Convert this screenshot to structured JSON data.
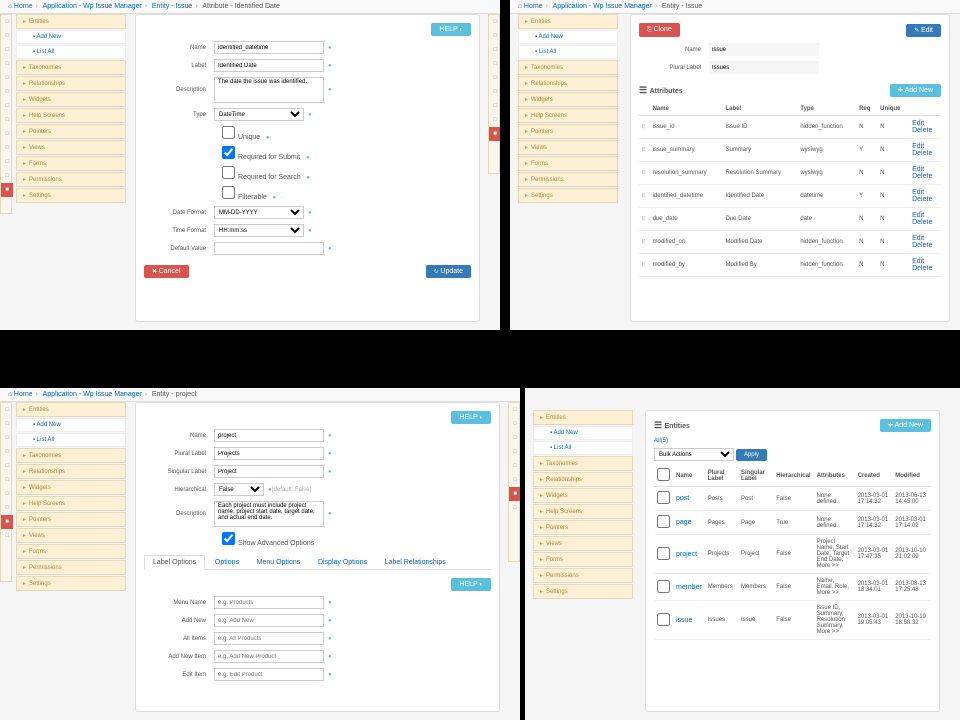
{
  "q1": {
    "crumbs": [
      "Home",
      "Application - Wp Issue Manager",
      "Entity - Issue",
      "Attribute - Identified Date"
    ],
    "sidebar": [
      {
        "t": "sec",
        "label": "Entities"
      },
      {
        "t": "sub",
        "label": "Add New"
      },
      {
        "t": "sub",
        "label": "List All"
      },
      {
        "t": "sec",
        "label": "Taxonomies"
      },
      {
        "t": "sec",
        "label": "Relationships"
      },
      {
        "t": "sec",
        "label": "Widgets"
      },
      {
        "t": "sec",
        "label": "Help Screens"
      },
      {
        "t": "sec",
        "label": "Pointers"
      },
      {
        "t": "sec",
        "label": "Views"
      },
      {
        "t": "sec",
        "label": "Forms"
      },
      {
        "t": "sec",
        "label": "Permissions"
      },
      {
        "t": "sec",
        "label": "Settings"
      }
    ],
    "help": "HELP",
    "fields": {
      "name_l": "Name",
      "name_v": "identified_datetime",
      "label_l": "Label",
      "label_v": "Identified Date",
      "desc_l": "Description",
      "desc_v": "The date the issue was identified.",
      "type_l": "Type",
      "type_v": "DateTime",
      "unique": "Unique",
      "reqsub": "Required for Submit",
      "reqsea": "Required for Search",
      "filt": "Filterable",
      "datef_l": "Date Format",
      "datef_v": "MM-DD-YYYY",
      "timef_l": "Time Format",
      "timef_v": "HH:mm:ss",
      "defv_l": "Default Value"
    },
    "cancel": "Cancel",
    "update": "Update"
  },
  "q2": {
    "crumbs": [
      "Home",
      "Application - Wp Issue Manager",
      "Entity - Issue"
    ],
    "sidebar": [
      {
        "t": "sec",
        "label": "Entities"
      },
      {
        "t": "sub",
        "label": "Add New"
      },
      {
        "t": "sub",
        "label": "List All"
      },
      {
        "t": "sec",
        "label": "Taxonomies"
      },
      {
        "t": "sec",
        "label": "Relationships"
      },
      {
        "t": "sec",
        "label": "Widgets"
      },
      {
        "t": "sec",
        "label": "Help Screens"
      },
      {
        "t": "sec",
        "label": "Pointers"
      },
      {
        "t": "sec",
        "label": "Views"
      },
      {
        "t": "sec",
        "label": "Forms"
      },
      {
        "t": "sec",
        "label": "Permissions"
      },
      {
        "t": "sec",
        "label": "Settings"
      }
    ],
    "clone": "Clone",
    "edit": "Edit",
    "name_l": "Name",
    "name_v": "issue",
    "plural_l": "Plural Label",
    "plural_v": "Issues",
    "attrs_title": "Attributes",
    "addnew": "Add New",
    "cols": {
      "name": "Name",
      "label": "Label",
      "type": "Type",
      "req": "Req",
      "unique": "Unique"
    },
    "rows": [
      {
        "name": "issue_id",
        "label": "Issue ID",
        "type": "hidden_function",
        "req": "N",
        "unique": "N"
      },
      {
        "name": "issue_summary",
        "label": "Summary",
        "type": "wysiwyg",
        "req": "Y",
        "unique": "N"
      },
      {
        "name": "resolution_summary",
        "label": "Resolution Summary",
        "type": "wysiwyg",
        "req": "N",
        "unique": "N"
      },
      {
        "name": "identified_datetime",
        "label": "Identified Date",
        "type": "datetime",
        "req": "Y",
        "unique": "N"
      },
      {
        "name": "due_date",
        "label": "Due Date",
        "type": "date",
        "req": "N",
        "unique": "N"
      },
      {
        "name": "modified_on",
        "label": "Modified Date",
        "type": "hidden_function",
        "req": "N",
        "unique": "N"
      },
      {
        "name": "modified_by",
        "label": "Modified By",
        "type": "hidden_function",
        "req": "N",
        "unique": "N"
      }
    ],
    "editlink": "Edit",
    "deletelink": "Delete"
  },
  "q3": {
    "crumbs": [
      "Home",
      "Application - Wp Issue Manager",
      "Entity - project"
    ],
    "sidebar": [
      {
        "t": "sec",
        "label": "Entities"
      },
      {
        "t": "sub",
        "label": "Add New"
      },
      {
        "t": "sub",
        "label": "List All"
      },
      {
        "t": "sec",
        "label": "Taxonomies"
      },
      {
        "t": "sec",
        "label": "Relationships"
      },
      {
        "t": "sec",
        "label": "Widgets"
      },
      {
        "t": "sec",
        "label": "Help Screens"
      },
      {
        "t": "sec",
        "label": "Pointers"
      },
      {
        "t": "sec",
        "label": "Views"
      },
      {
        "t": "sec",
        "label": "Forms"
      },
      {
        "t": "sec",
        "label": "Permissions"
      },
      {
        "t": "sec",
        "label": "Settings"
      }
    ],
    "help": "HELP",
    "fields": {
      "name_l": "Name",
      "name_v": "project",
      "plural_l": "Plural Label",
      "plural_v": "Projects",
      "sing_l": "Singular Label",
      "sing_v": "Project",
      "hier_l": "Hierarchical",
      "hier_v": "False",
      "hier_hint": "(default: False)",
      "desc_l": "Description",
      "desc_v": "Each project must include project name, project start date, target date, and actual end date.",
      "showadv": "Show Advanced Options"
    },
    "tabs": [
      "Label Options",
      "Options",
      "Menu Options",
      "Display Options",
      "Label Relationships"
    ],
    "f2": {
      "menu_l": "Menu Name",
      "menu_p": "e.g. Products",
      "addnew_l": "Add New",
      "addnew_p": "e.g. Add New",
      "all_l": "All Items",
      "all_p": "e.g. All Products",
      "addni_l": "Add New Item",
      "addni_p": "e.g. Add New Product",
      "edit_l": "Edit Item",
      "edit_p": "e.g. Edit Product"
    }
  },
  "q4": {
    "sidebar": [
      {
        "t": "sec",
        "label": "Entities"
      },
      {
        "t": "sub",
        "label": "Add New"
      },
      {
        "t": "sub",
        "label": "List All"
      },
      {
        "t": "sec",
        "label": "Taxonomies"
      },
      {
        "t": "sec",
        "label": "Relationships"
      },
      {
        "t": "sec",
        "label": "Widgets"
      },
      {
        "t": "sec",
        "label": "Help Screens"
      },
      {
        "t": "sec",
        "label": "Pointers"
      },
      {
        "t": "sec",
        "label": "Views"
      },
      {
        "t": "sec",
        "label": "Forms"
      },
      {
        "t": "sec",
        "label": "Permissions"
      },
      {
        "t": "sec",
        "label": "Settings"
      }
    ],
    "title": "Entities",
    "addnew": "Add New",
    "allcount": "All(5)",
    "bulk": "Bulk Actions",
    "apply": "Apply",
    "cols": {
      "name": "Name",
      "plural": "Plural Label",
      "sing": "Singular Label",
      "hier": "Hierarchical",
      "attrs": "Attributes",
      "created": "Created",
      "modified": "Modified"
    },
    "rows": [
      {
        "name": "post",
        "plural": "Posts",
        "sing": "Post",
        "hier": "False",
        "attrs": "None defined.",
        "created": "2013-03-01 17:14:32",
        "modified": "2013-06-13 14:45:00"
      },
      {
        "name": "page",
        "plural": "Pages",
        "sing": "Page",
        "hier": "True",
        "attrs": "None defined.",
        "created": "2013-03-01 17:14:32",
        "modified": "2013-03-01 17:14:02"
      },
      {
        "name": "project",
        "plural": "Projects",
        "sing": "Project",
        "hier": "False",
        "attrs": "Project Name, Start Date, Target End Date, More >>",
        "created": "2013-03-01 17:47:35",
        "modified": "2013-10-10 21:02:09"
      },
      {
        "name": "member",
        "plural": "Members",
        "sing": "Members",
        "hier": "False",
        "attrs": "Name, Email, Role, More >>",
        "created": "2013-03-01 18:34:01",
        "modified": "2013-08-13 17:25:48"
      },
      {
        "name": "issue",
        "plural": "Issues",
        "sing": "Issue",
        "hier": "False",
        "attrs": "Issue ID, Summary, Resolution Summary, More >>",
        "created": "2013-03-01 19:05:43",
        "modified": "2013-10-19 18:58:32"
      }
    ]
  }
}
